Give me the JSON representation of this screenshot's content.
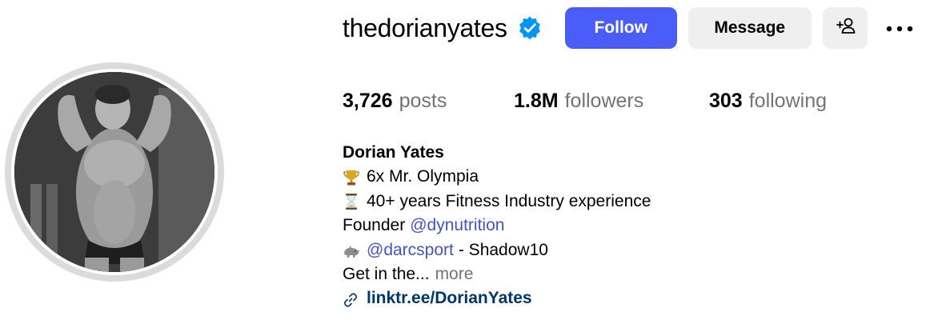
{
  "profile": {
    "username": "thedorianyates",
    "verified_icon": "verified-badge-icon",
    "accent_color": "#4a5df9",
    "actions": {
      "follow_label": "Follow",
      "message_label": "Message",
      "suggest_icon": "add-person-icon",
      "suggest_label": "+♙",
      "more_icon": "more-horizontal-icon"
    },
    "stats": {
      "posts": {
        "value": "3,726",
        "label": "posts"
      },
      "followers": {
        "value": "1.8M",
        "label": "followers"
      },
      "following": {
        "value": "303",
        "label": "following"
      }
    },
    "bio": {
      "name": "Dorian Yates",
      "line1": {
        "icon": "trophy-icon",
        "text": "6x Mr. Olympia"
      },
      "line2": {
        "icon": "hourglass-icon",
        "text": "40+ years Fitness Industry experience"
      },
      "line3": {
        "prefix": "Founder",
        "mention": "@dynutrition"
      },
      "line4": {
        "icon": "rhino-icon",
        "mention": "@darcsport",
        "suffix": "- Shadow10"
      },
      "line5": {
        "text": "Get in the...",
        "more": "more"
      },
      "link": {
        "icon": "link-icon",
        "text": "linktr.ee/DorianYates"
      }
    }
  }
}
